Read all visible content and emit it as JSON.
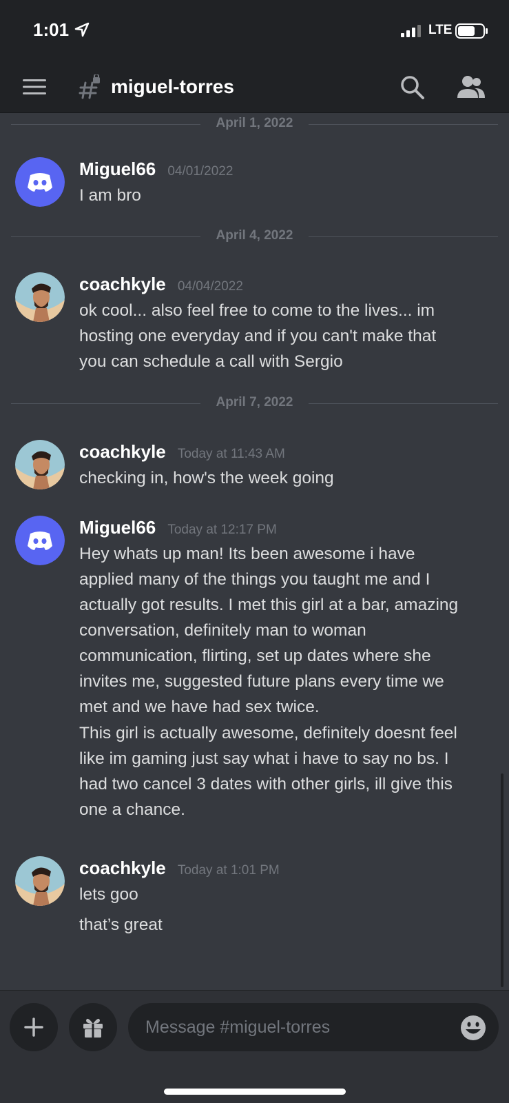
{
  "status_bar": {
    "time": "1:01",
    "network": "LTE"
  },
  "header": {
    "channel_name": "miguel-torres"
  },
  "messages": {
    "divider_1": "April 1, 2022",
    "msg_1": {
      "author": "Miguel66",
      "timestamp": "04/01/2022",
      "lines": [
        "I am bro"
      ]
    },
    "divider_2": "April 4, 2022",
    "msg_2": {
      "author": "coachkyle",
      "timestamp": "04/04/2022",
      "lines": [
        "ok cool... also feel free to come to the lives... im",
        "hosting one everyday and if you can't make that",
        "you can schedule a call with Sergio"
      ]
    },
    "divider_3": "April 7, 2022",
    "msg_3": {
      "author": "coachkyle",
      "timestamp": "Today at 11:43 AM",
      "lines": [
        "checking in, how's the week going"
      ]
    },
    "msg_4": {
      "author": "Miguel66",
      "timestamp": "Today at 12:17 PM",
      "lines": [
        "Hey whats up man! Its been awesome i have",
        "applied many of the things you taught me and I",
        "actually got results. I met this girl at a bar, amazing",
        "conversation, definitely man to woman",
        "communication, flirting, set up dates where she",
        "invites me, suggested future plans every time we",
        "met and we have had sex twice."
      ],
      "lines_2": [
        "This girl is actually awesome, definitely doesnt feel",
        "like im gaming just say what i have to say no bs. I",
        "had two cancel 3 dates with other girls, ill give this",
        "one a chance."
      ]
    },
    "msg_5": {
      "author": "coachkyle",
      "timestamp": "Today at 1:01 PM",
      "lines": [
        "lets goo"
      ],
      "lines_2": [
        "that’s great"
      ]
    }
  },
  "composer": {
    "placeholder": "Message #miguel-torres"
  },
  "colors": {
    "background": "#36393f",
    "header": "#202225",
    "discord_blurple": "#5865f2",
    "muted": "#72767d"
  },
  "icons": [
    "location-icon",
    "signal-icon",
    "battery-icon",
    "menu-icon",
    "channel-hash-icon",
    "search-icon",
    "members-icon",
    "discord-avatar-icon",
    "plus-icon",
    "gift-icon",
    "emoji-icon"
  ]
}
